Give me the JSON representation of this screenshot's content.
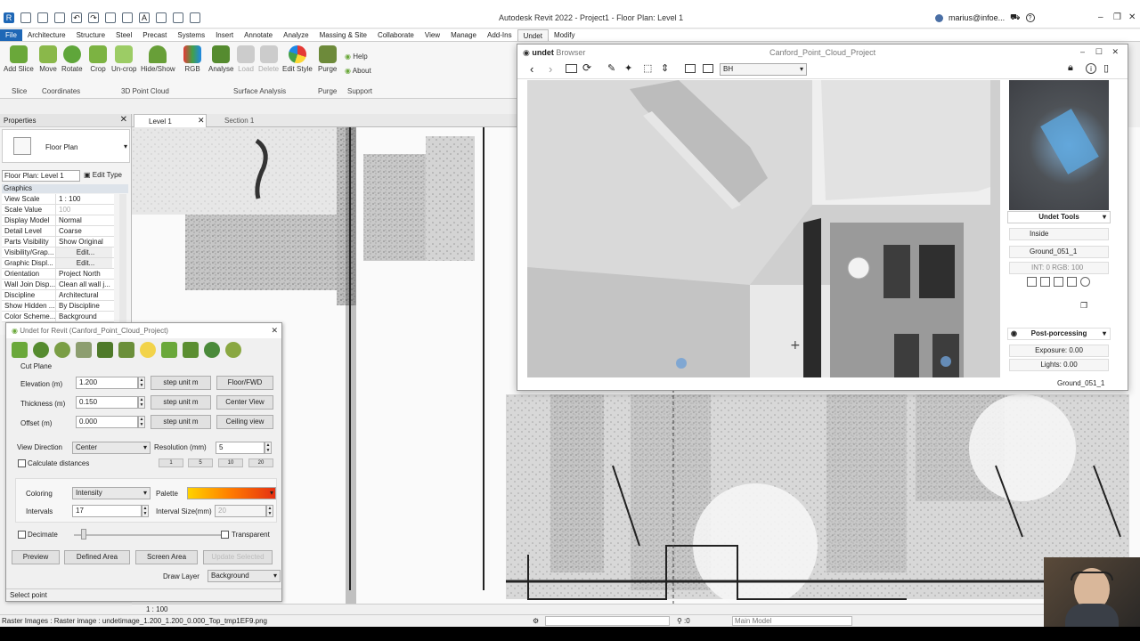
{
  "window": {
    "title": "Autodesk Revit 2022 - Project1 - Floor Plan: Level 1",
    "user": "marius@infoe...",
    "help": "?"
  },
  "menu": [
    "File",
    "Architecture",
    "Structure",
    "Steel",
    "Precast",
    "Systems",
    "Insert",
    "Annotate",
    "Analyze",
    "Massing & Site",
    "Collaborate",
    "View",
    "Manage",
    "Add-Ins",
    "Undet",
    "Modify"
  ],
  "ribbon": {
    "buttons": [
      "Add Slice",
      "Move",
      "Rotate",
      "Crop",
      "Un-crop",
      "Hide/Show",
      "RGB",
      "Analyse",
      "Load",
      "Delete",
      "Edit Style",
      "Purge",
      "Help",
      "About"
    ],
    "groups": [
      "Slice",
      "Coordinates",
      "3D Point Cloud",
      "Surface Analysis",
      "Purge",
      "Support"
    ]
  },
  "tabs": {
    "level1": "Level 1",
    "section1": "Section 1"
  },
  "properties": {
    "title": "Properties",
    "type": "Floor Plan",
    "selector": "Floor Plan: Level 1",
    "edit_type": "Edit Type",
    "section": "Graphics",
    "rows": [
      {
        "k": "View Scale",
        "v": "1 : 100"
      },
      {
        "k": "Scale Value",
        "v": "100"
      },
      {
        "k": "Display Model",
        "v": "Normal"
      },
      {
        "k": "Detail Level",
        "v": "Coarse"
      },
      {
        "k": "Parts Visibility",
        "v": "Show Original"
      },
      {
        "k": "Visibility/Grap...",
        "v": "Edit..."
      },
      {
        "k": "Graphic Displ...",
        "v": "Edit..."
      },
      {
        "k": "Orientation",
        "v": "Project North"
      },
      {
        "k": "Wall Join Disp...",
        "v": "Clean all wall j..."
      },
      {
        "k": "Discipline",
        "v": "Architectural"
      },
      {
        "k": "Show Hidden ...",
        "v": "By Discipline"
      },
      {
        "k": "Color Scheme...",
        "v": "Background"
      }
    ]
  },
  "undet_panel": {
    "title": "Undet for Revit (Canford_Point_Cloud_Project)",
    "cut_plane": "Cut Plane",
    "elevation_label": "Elevation (m)",
    "elevation": "1.200",
    "thickness_label": "Thickness (m)",
    "thickness": "0.150",
    "offset_label": "Offset (m)",
    "offset": "0.000",
    "step_unit": "step unit m",
    "floor_fwd": "Floor/FWD",
    "center_view": "Center View",
    "ceiling_view": "Ceiling view",
    "view_direction_label": "View Direction",
    "view_direction": "Center",
    "resolution_label": "Resolution (mm)",
    "resolution": "5",
    "calc_distances": "Calculate distances",
    "res_presets": [
      "1",
      "5",
      "10",
      "20"
    ],
    "coloring_label": "Coloring",
    "coloring": "Intensity",
    "palette_label": "Palette",
    "intervals_label": "Intervals",
    "intervals": "17",
    "interval_size_label": "Interval Size(mm)",
    "interval_size": "20",
    "decimate": "Decimate",
    "transparent": "Transparent",
    "preview": "Preview",
    "defined_area": "Defined Area",
    "screen_area": "Screen Area",
    "update_selected": "Update Selected",
    "draw_layer_label": "Draw Layer",
    "draw_layer": "Background",
    "status": "Select point"
  },
  "browser": {
    "brand": "undet",
    "brand_sub": "Browser",
    "title": "Canford_Point_Cloud_Project",
    "dropdown": "BH",
    "undet_tools": "Undet Tools",
    "inside": "Inside",
    "ground": "Ground_051_1",
    "int_rgb": "INT: 0 RGB: 100",
    "post_processing": "Post-porcessing",
    "exposure": "Exposure: 0.00",
    "lights": "Lights: 0.00",
    "footer": "Ground_051_1"
  },
  "viewbar": {
    "scale": "1 : 100"
  },
  "status": {
    "text": "Raster Images : Raster image : undetimage_1.200_1.200_0.000_Top_tmp1EF9.png",
    "selection": ":0",
    "model": "Main Model"
  }
}
